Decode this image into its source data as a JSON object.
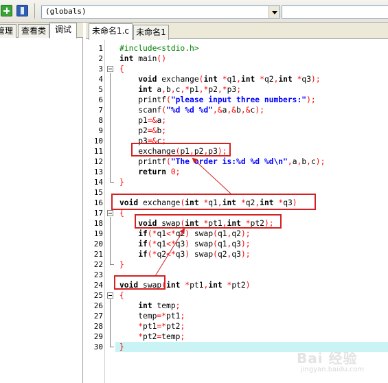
{
  "toolbar": {
    "add_icon": "add-project-icon",
    "book_icon": "book-icon",
    "globals_value": "(globals)"
  },
  "left_panel": {
    "tabs": [
      {
        "label": "管理"
      },
      {
        "label": "查看类"
      },
      {
        "label": "调试"
      }
    ],
    "active_tab": "调试"
  },
  "editor": {
    "tabs": [
      {
        "label": "未命名1.c"
      },
      {
        "label": "未命名1"
      }
    ],
    "active_tab": "未命名1.c",
    "current_line": 30,
    "lines": [
      {
        "n": "1",
        "text": "#include<stdio.h>"
      },
      {
        "n": "2",
        "text": "int main()"
      },
      {
        "n": "3",
        "text": "{"
      },
      {
        "n": "4",
        "text": "    void exchange(int *q1,int *q2,int *q3);"
      },
      {
        "n": "5",
        "text": "    int a,b,c,*p1,*p2,*p3;"
      },
      {
        "n": "6",
        "text": "    printf(\"please input three numbers:\");"
      },
      {
        "n": "7",
        "text": "    scanf(\"%d %d %d\",&a,&b,&c);"
      },
      {
        "n": "8",
        "text": "    p1=&a;"
      },
      {
        "n": "9",
        "text": "    p2=&b;"
      },
      {
        "n": "10",
        "text": "    p3=&c;"
      },
      {
        "n": "11",
        "text": "    exchange(p1,p2,p3);"
      },
      {
        "n": "12",
        "text": "    printf(\"The order is:%d %d %d\\n\",a,b,c);"
      },
      {
        "n": "13",
        "text": "    return 0;"
      },
      {
        "n": "14",
        "text": "}"
      },
      {
        "n": "15",
        "text": ""
      },
      {
        "n": "16",
        "text": "void exchange(int *q1,int *q2,int *q3)"
      },
      {
        "n": "17",
        "text": "{"
      },
      {
        "n": "18",
        "text": "    void swap(int *pt1,int *pt2);"
      },
      {
        "n": "19",
        "text": "    if(*q1<*q2) swap(q1,q2);"
      },
      {
        "n": "20",
        "text": "    if(*q1<*q3) swap(q1,q3);"
      },
      {
        "n": "21",
        "text": "    if(*q2<*q3) swap(q2,q3);"
      },
      {
        "n": "22",
        "text": "}"
      },
      {
        "n": "23",
        "text": ""
      },
      {
        "n": "24",
        "text": "void swap(int *pt1,int *pt2)"
      },
      {
        "n": "25",
        "text": "{"
      },
      {
        "n": "26",
        "text": "    int temp;"
      },
      {
        "n": "27",
        "text": "    temp=*pt1;"
      },
      {
        "n": "28",
        "text": "    *pt1=*pt2;"
      },
      {
        "n": "29",
        "text": "    *pt2=temp;"
      },
      {
        "n": "30",
        "text": "}"
      }
    ]
  },
  "annotations": {
    "color": "#d42020",
    "boxes": [
      "exchange(p1,p2,p3);",
      "void exchange(int *q1,int *q2,int *q3)",
      "void swap(int *pt1,int *pt2);",
      "void swap"
    ]
  },
  "watermark": {
    "main": "Bai 经验",
    "sub": "jingyan.baidu.com"
  }
}
